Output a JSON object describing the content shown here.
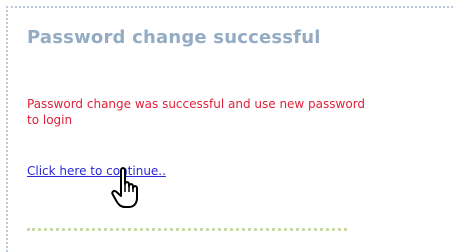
{
  "dialog": {
    "title": "Password change successful",
    "message": "Password change was successful and use new password to login",
    "continue_link": "Click here to continue..",
    "cursor_icon": "hand-pointer-icon"
  },
  "colors": {
    "title": "#94abc4",
    "message": "#e0203a",
    "link": "#2a2ad6",
    "border": "#b9c9da",
    "separator": "#c9d9a8"
  }
}
